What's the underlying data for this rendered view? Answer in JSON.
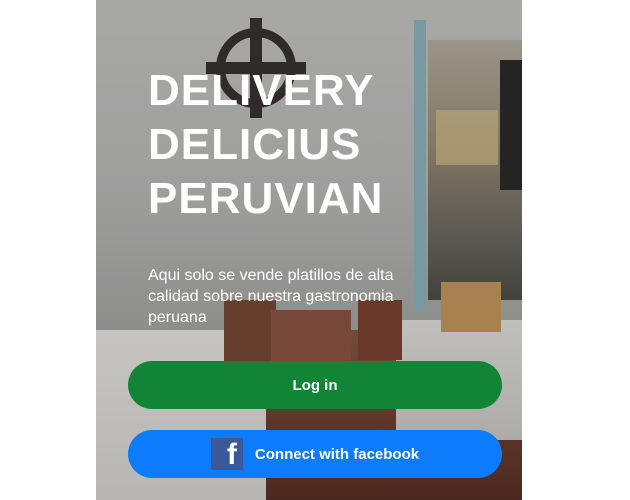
{
  "hero": {
    "title_lines": [
      "DELIVERY",
      "DELICIUS",
      "PERUVIAN"
    ],
    "subtitle": "Aqui solo se vende platillos de alta calidad sobre nuestra gastronomia peruana"
  },
  "actions": {
    "login_label": "Log in",
    "facebook_label": "Connect with facebook"
  },
  "icons": {
    "facebook": "facebook-icon"
  },
  "colors": {
    "login_button": "#118535",
    "facebook_button": "#0c7cfc",
    "facebook_icon_bg": "#3b5998",
    "text": "#ffffff"
  }
}
